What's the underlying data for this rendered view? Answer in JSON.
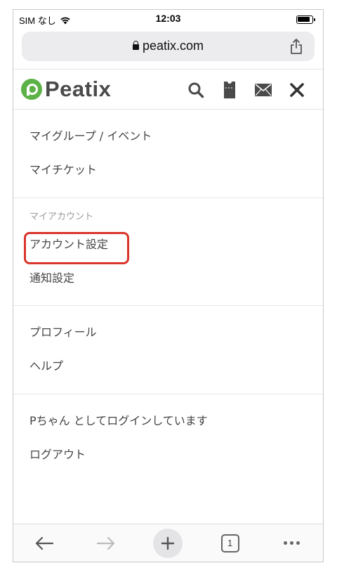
{
  "status_bar": {
    "carrier": "SIM なし",
    "time": "12:03"
  },
  "browser": {
    "url": "peatix.com",
    "open_tabs": "1"
  },
  "header": {
    "logo_text": "Peatix"
  },
  "menu": {
    "section1": [
      "マイグループ / イベント",
      "マイチケット"
    ],
    "section2_label": "マイアカウント",
    "section2": [
      "アカウント設定",
      "通知設定"
    ],
    "section3": [
      "プロフィール",
      "ヘルプ"
    ],
    "section4": [
      "Pちゃん としてログインしています",
      "ログアウト"
    ]
  },
  "colors": {
    "brand": "#5db247",
    "highlight": "#d9352b"
  }
}
